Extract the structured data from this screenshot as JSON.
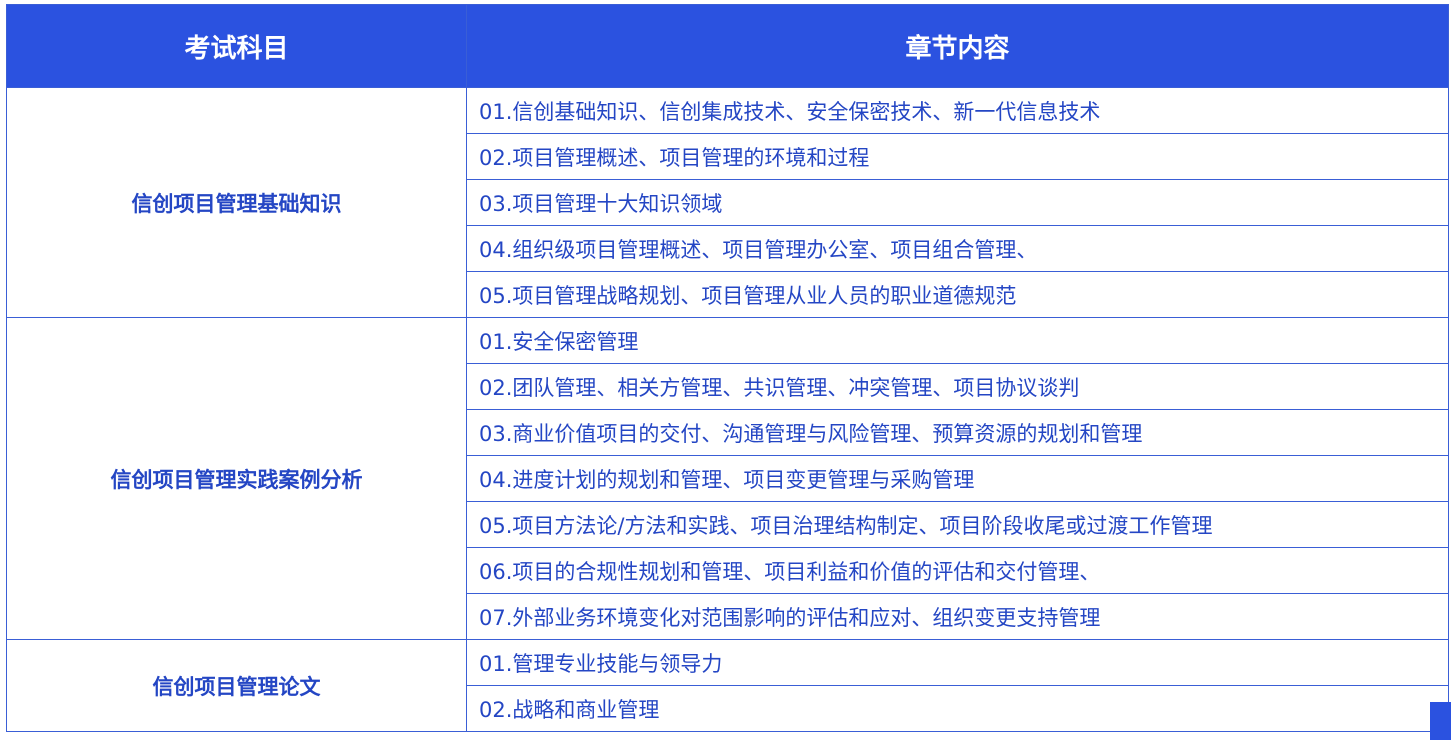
{
  "header": {
    "subject_label": "考试科目",
    "content_label": "章节内容"
  },
  "groups": [
    {
      "subject": "信创项目管理基础知识",
      "chapters": [
        "01.信创基础知识、信创集成技术、安全保密技术、新一代信息技术",
        "02.项目管理概述、项目管理的环境和过程",
        "03.项目管理十大知识领域",
        "04.组织级项目管理概述、项目管理办公室、项目组合管理、",
        "05.项目管理战略规划、项目管理从业人员的职业道德规范"
      ]
    },
    {
      "subject": "信创项目管理实践案例分析",
      "chapters": [
        "01.安全保密管理",
        "02.团队管理、相关方管理、共识管理、冲突管理、项目协议谈判",
        "03.商业价值项目的交付、沟通管理与风险管理、预算资源的规划和管理",
        "04.进度计划的规划和管理、项目变更管理与采购管理",
        "05.项目方法论/方法和实践、项目治理结构制定、项目阶段收尾或过渡工作管理",
        "06.项目的合规性规划和管理、项目利益和价值的评估和交付管理、",
        "07.外部业务环境变化对范围影响的评估和应对、组织变更支持管理"
      ]
    },
    {
      "subject": "信创项目管理论文",
      "chapters": [
        "01.管理专业技能与领导力",
        "02.战略和商业管理"
      ]
    }
  ]
}
